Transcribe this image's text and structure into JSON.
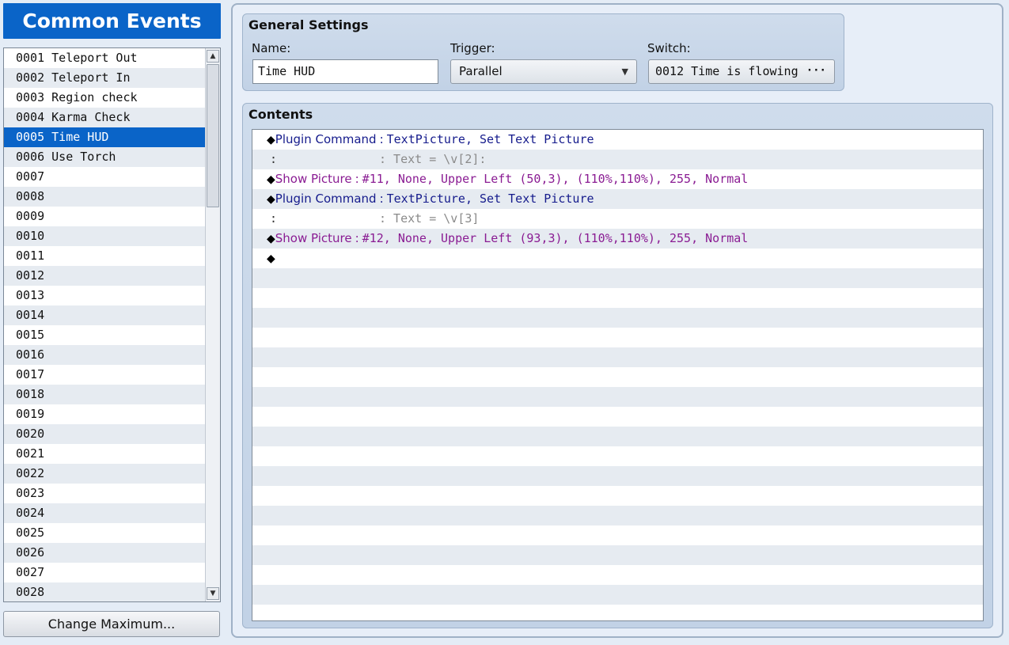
{
  "sidebar": {
    "title": "Common Events",
    "selected_index": 4,
    "events": [
      {
        "id": "0001",
        "name": "Teleport Out"
      },
      {
        "id": "0002",
        "name": "Teleport In"
      },
      {
        "id": "0003",
        "name": "Region check"
      },
      {
        "id": "0004",
        "name": "Karma Check"
      },
      {
        "id": "0005",
        "name": "Time HUD"
      },
      {
        "id": "0006",
        "name": "Use Torch"
      },
      {
        "id": "0007",
        "name": ""
      },
      {
        "id": "0008",
        "name": ""
      },
      {
        "id": "0009",
        "name": ""
      },
      {
        "id": "0010",
        "name": ""
      },
      {
        "id": "0011",
        "name": ""
      },
      {
        "id": "0012",
        "name": ""
      },
      {
        "id": "0013",
        "name": ""
      },
      {
        "id": "0014",
        "name": ""
      },
      {
        "id": "0015",
        "name": ""
      },
      {
        "id": "0016",
        "name": ""
      },
      {
        "id": "0017",
        "name": ""
      },
      {
        "id": "0018",
        "name": ""
      },
      {
        "id": "0019",
        "name": ""
      },
      {
        "id": "0020",
        "name": ""
      },
      {
        "id": "0021",
        "name": ""
      },
      {
        "id": "0022",
        "name": ""
      },
      {
        "id": "0023",
        "name": ""
      },
      {
        "id": "0024",
        "name": ""
      },
      {
        "id": "0025",
        "name": ""
      },
      {
        "id": "0026",
        "name": ""
      },
      {
        "id": "0027",
        "name": ""
      },
      {
        "id": "0028",
        "name": ""
      }
    ],
    "change_max_label": "Change Maximum...",
    "scroll_up_icon": "triangle-up-icon",
    "scroll_down_icon": "triangle-down-icon"
  },
  "general": {
    "title": "General Settings",
    "name_label": "Name:",
    "name_value": "Time HUD",
    "trigger_label": "Trigger:",
    "trigger_value": "Parallel",
    "trigger_icon": "chevron-down-icon",
    "switch_label": "Switch:",
    "switch_value": "0012 Time is flowing",
    "switch_button": "···"
  },
  "contents": {
    "title": "Contents",
    "commands": [
      {
        "kind": "command",
        "color": "plugin",
        "name": "Plugin Command",
        "params": "TextPicture, Set Text Picture"
      },
      {
        "kind": "continuation",
        "text": "Text = \\v[2]:"
      },
      {
        "kind": "command",
        "color": "picture",
        "name": "Show Picture",
        "params": "#11, None, Upper Left (50,3), (110%,110%), 255, Normal"
      },
      {
        "kind": "command",
        "color": "plugin",
        "name": "Plugin Command",
        "params": "TextPicture, Set Text Picture"
      },
      {
        "kind": "continuation",
        "text": "Text = \\v[3]"
      },
      {
        "kind": "command",
        "color": "picture",
        "name": "Show Picture",
        "params": "#12, None, Upper Left (93,3), (110%,110%), 255, Normal"
      },
      {
        "kind": "empty"
      }
    ],
    "diamond_glyph": "◆",
    "separator_glyph": ":",
    "continuation_colon": ":",
    "blank_rows": 18
  },
  "colors": {
    "accent": "#0a64c8",
    "plugin_command": "#151b8c",
    "show_picture": "#8a1c93",
    "continuation": "#8a8a8a",
    "row_alt": "#e6ebf1"
  }
}
